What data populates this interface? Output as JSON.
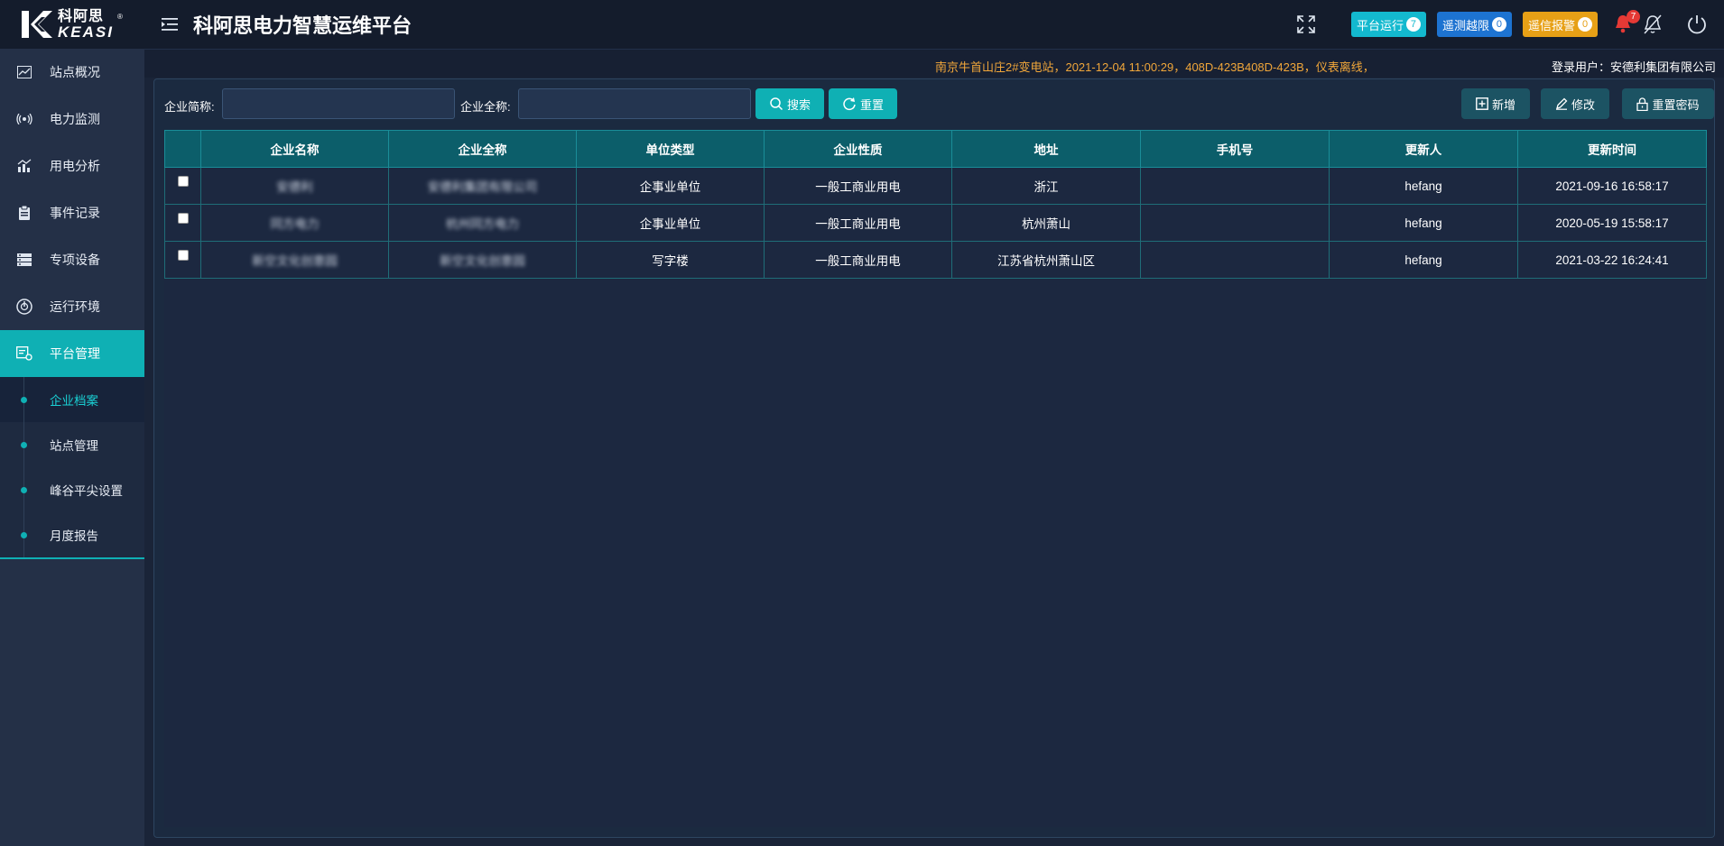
{
  "brand": {
    "name_cn": "科阿思",
    "name_en": "KEASI",
    "reg": "®"
  },
  "header": {
    "title": "科阿思电力智慧运维平台",
    "badges": [
      {
        "label": "平台运行",
        "count": "7"
      },
      {
        "label": "遥测越限",
        "count": "0"
      },
      {
        "label": "遥信报警",
        "count": "0"
      }
    ],
    "bell_count": "7"
  },
  "infobar": {
    "alarm": "南京牛首山庄2#变电站，2021-12-04 11:00:29，408D-423B408D-423B，仪表离线，",
    "login_user": "登录用户：安德利集团有限公司"
  },
  "sidebar": {
    "items": [
      {
        "label": "站点概况",
        "icon": "chart-line-icon"
      },
      {
        "label": "电力监测",
        "icon": "signal-icon"
      },
      {
        "label": "用电分析",
        "icon": "bar-chart-icon"
      },
      {
        "label": "事件记录",
        "icon": "clipboard-icon"
      },
      {
        "label": "专项设备",
        "icon": "server-icon"
      },
      {
        "label": "运行环境",
        "icon": "gauge-icon"
      },
      {
        "label": "平台管理",
        "icon": "settings-doc-icon"
      }
    ],
    "sub_items": [
      {
        "label": "企业档案"
      },
      {
        "label": "站点管理"
      },
      {
        "label": "峰谷平尖设置"
      },
      {
        "label": "月度报告"
      }
    ]
  },
  "filters": {
    "short_name_label": "企业简称:",
    "short_name_value": "",
    "full_name_label": "企业全称:",
    "full_name_value": "",
    "search_label": "搜索",
    "reset_label": "重置"
  },
  "actions": {
    "add_label": "新增",
    "edit_label": "修改",
    "reset_pwd_label": "重置密码"
  },
  "table": {
    "columns": [
      "企业名称",
      "企业全称",
      "单位类型",
      "企业性质",
      "地址",
      "手机号",
      "更新人",
      "更新时间"
    ],
    "rows": [
      {
        "name": "安德利",
        "full_name": "安德利集团有限公司",
        "unit_type": "企事业单位",
        "nature": "一般工商业用电",
        "address": "浙江",
        "phone": "",
        "updater": "hefang",
        "updated": "2021-09-16 16:58:17"
      },
      {
        "name": "同方电力",
        "full_name": "杭州同方电力",
        "unit_type": "企事业单位",
        "nature": "一般工商业用电",
        "address": "杭州萧山",
        "phone": "",
        "updater": "hefang",
        "updated": "2020-05-19 15:58:17"
      },
      {
        "name": "新空文化创意园",
        "full_name": "新空文化创意园",
        "unit_type": "写字楼",
        "nature": "一般工商业用电",
        "address": "江苏省杭州萧山区",
        "phone": "",
        "updater": "hefang",
        "updated": "2021-03-22 16:24:41"
      }
    ]
  }
}
